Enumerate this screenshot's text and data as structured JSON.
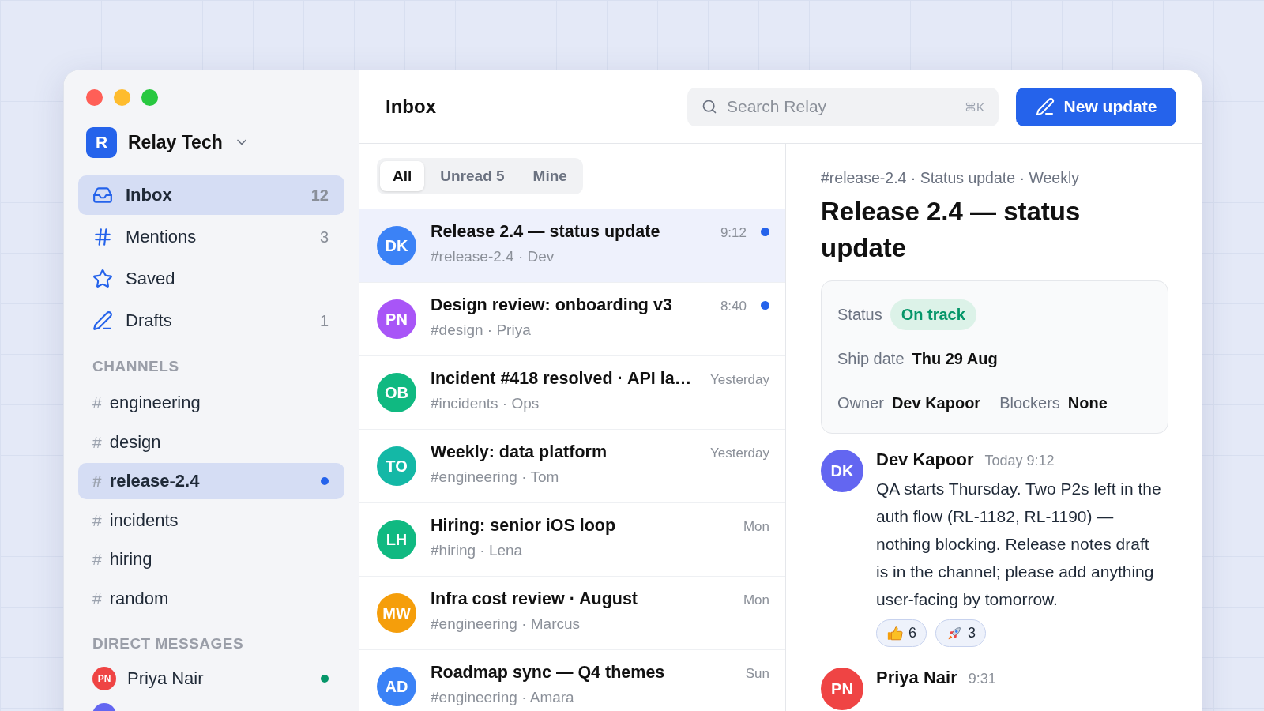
{
  "workspace": {
    "initial": "R",
    "name": "Relay Tech"
  },
  "nav": [
    {
      "kind": "inbox",
      "label": "Inbox",
      "count": "12",
      "selected": true
    },
    {
      "kind": "hash",
      "label": "Mentions",
      "count": "3",
      "selected": false
    },
    {
      "kind": "star",
      "label": "Saved",
      "selected": false
    },
    {
      "kind": "pen",
      "label": "Drafts",
      "count": "1",
      "selected": false
    }
  ],
  "channels_heading": "CHANNELS",
  "channels": [
    {
      "symbol": "#",
      "name": "engineering",
      "selected": false,
      "unread": false
    },
    {
      "symbol": "#",
      "name": "design",
      "selected": false,
      "unread": false
    },
    {
      "symbol": "#",
      "name": "release-2.4",
      "selected": true,
      "unread": true
    },
    {
      "symbol": "#",
      "name": "incidents",
      "selected": false,
      "unread": false
    },
    {
      "symbol": "#",
      "name": "hiring",
      "selected": false,
      "unread": false
    },
    {
      "symbol": "#",
      "name": "random",
      "selected": false,
      "unread": false
    }
  ],
  "dm_heading": "DIRECT MESSAGES",
  "direct_messages": [
    {
      "initials": "PN",
      "name": "Priya Nair",
      "color": "#ef4444",
      "online": true
    },
    {
      "color": "#6366f1"
    }
  ],
  "header": {
    "title": "Inbox",
    "search": {
      "placeholder": "Search Relay",
      "shortcut": "⌘K"
    },
    "new_button": "New update"
  },
  "filters": [
    {
      "label": "All",
      "selected": true
    },
    {
      "label": "Unread 5",
      "selected": false
    },
    {
      "label": "Mine",
      "selected": false
    }
  ],
  "threads": [
    {
      "initials": "DK",
      "color": "#3b82f6",
      "title": "Release 2.4 — status update",
      "meta": "#release-2.4 · Dev",
      "time": "9:12",
      "unread": true,
      "selected": true
    },
    {
      "initials": "PN",
      "color": "#a855f7",
      "title": "Design review: onboarding v3",
      "meta": "#design · Priya",
      "time": "8:40",
      "unread": true,
      "selected": false
    },
    {
      "initials": "OB",
      "color": "#10b981",
      "title": "Incident #418 resolved · API la…",
      "meta": "#incidents · Ops",
      "time": "Yesterday",
      "unread": false,
      "selected": false
    },
    {
      "initials": "TO",
      "color": "#14b8a6",
      "title": "Weekly: data platform",
      "meta": "#engineering · Tom",
      "time": "Yesterday",
      "unread": false,
      "selected": false
    },
    {
      "initials": "LH",
      "color": "#10b981",
      "title": "Hiring: senior iOS loop",
      "meta": "#hiring · Lena",
      "time": "Mon",
      "unread": false,
      "selected": false
    },
    {
      "initials": "MW",
      "color": "#f59e0b",
      "title": "Infra cost review · August",
      "meta": "#engineering · Marcus",
      "time": "Mon",
      "unread": false,
      "selected": false
    },
    {
      "initials": "AD",
      "color": "#3b82f6",
      "title": "Roadmap sync — Q4 themes",
      "meta": "#engineering · Amara",
      "time": "Sun",
      "unread": false,
      "selected": false
    }
  ],
  "detail": {
    "breadcrumb": "#release-2.4 · Status update · Weekly",
    "title": "Release 2.4 — status update",
    "fields": [
      [
        {
          "label": "Status",
          "value": "On track",
          "kind": "badge"
        }
      ],
      [
        {
          "label": "Ship date",
          "value": "Thu 29 Aug",
          "kind": "text"
        }
      ],
      [
        {
          "label": "Owner",
          "value": "Dev Kapoor",
          "kind": "text"
        },
        {
          "label": "Blockers",
          "value": "None",
          "kind": "text"
        }
      ]
    ],
    "messages": [
      {
        "initials": "DK",
        "color": "#6366f1",
        "author": "Dev Kapoor",
        "time": "Today 9:12",
        "body": "QA starts Thursday. Two P2s left in the auth flow (RL-1182, RL-1190) — nothing blocking. Release notes draft is in the channel; please add anything user-facing by tomorrow.",
        "reactions": [
          {
            "kind": "thumbs-up",
            "count": "6"
          },
          {
            "kind": "rocket",
            "count": "3"
          }
        ]
      },
      {
        "initials": "PN",
        "color": "#ef4444",
        "author": "Priya Nair",
        "time": "9:31"
      }
    ]
  }
}
